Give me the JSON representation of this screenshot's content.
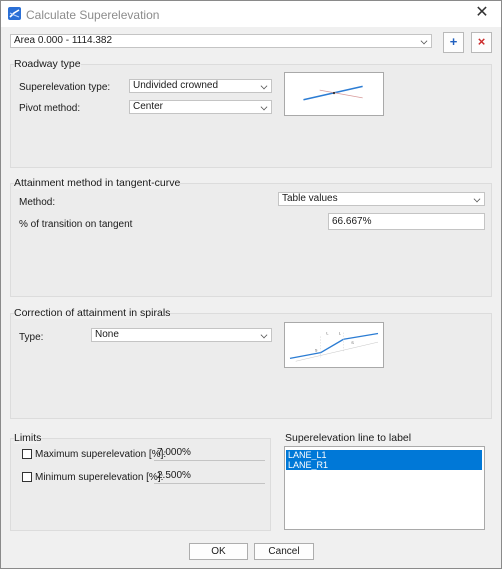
{
  "window": {
    "title": "Calculate Superelevation"
  },
  "area": {
    "selected": "Area 0.000 - 1114.382",
    "add_label": "+",
    "remove_label": "×"
  },
  "roadway": {
    "title": "Roadway type",
    "type_label": "Superelevation type:",
    "type_value": "Undivided crowned",
    "pivot_label": "Pivot method:",
    "pivot_value": "Center"
  },
  "attainment": {
    "title": "Attainment method in tangent-curve",
    "method_label": "Method:",
    "method_value": "Table values",
    "transition_label": "% of transition on tangent",
    "transition_value": "66.667%"
  },
  "correction": {
    "title": "Correction of attainment in spirals",
    "type_label": "Type:",
    "type_value": "None",
    "diagram_labels": [
      "L",
      "L",
      "S",
      "S"
    ]
  },
  "limits": {
    "title": "Limits",
    "max_label": "Maximum superelevation [%]:",
    "max_value": "7.000%",
    "min_label": "Minimum superelevation [%]:",
    "min_value": "2.500%"
  },
  "label_lines": {
    "title": "Superelevation line to label",
    "items": [
      "LANE_L1",
      "LANE_R1"
    ]
  },
  "footer": {
    "ok_label": "OK",
    "cancel_label": "Cancel"
  },
  "colors": {
    "accent": "#0078d7",
    "add_blue": "#1f5fbf",
    "remove_red": "#cc2a2a"
  },
  "icons": {
    "app": "superelevation-app-icon",
    "close": "close-icon",
    "dropdown": "chevron-down-icon"
  }
}
